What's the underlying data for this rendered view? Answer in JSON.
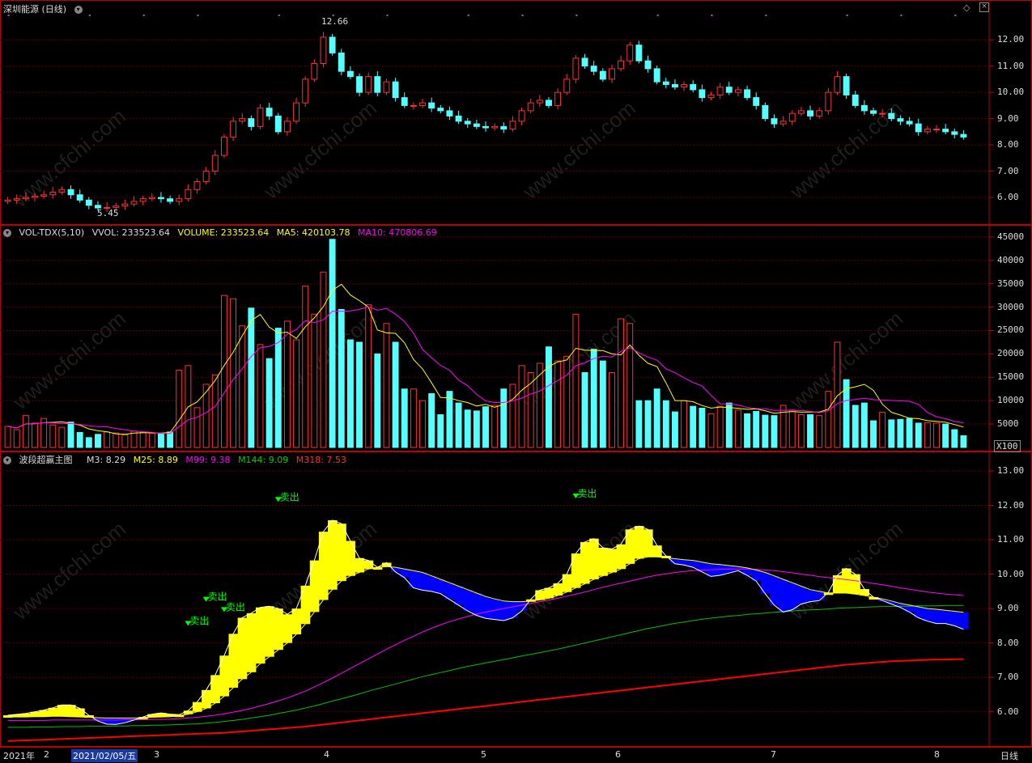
{
  "price_panel": {
    "title": "深圳能源 (日线)",
    "high_label": "12.66",
    "low_label": "5.45",
    "y_ticks": [
      "12.00",
      "11.00",
      "10.00",
      "9.00",
      "8.00",
      "7.00",
      "6.00"
    ],
    "y_values": [
      12,
      11,
      10,
      9,
      8,
      7,
      6
    ]
  },
  "vol_panel": {
    "name": "VOL-TDX(5,10)",
    "vvol": "VVOL: 233523.64",
    "volume": "VOLUME: 233523.64",
    "ma5": "MA5: 420103.78",
    "ma10": "MA10: 470806.69",
    "y_ticks": [
      "45000",
      "40000",
      "35000",
      "30000",
      "25000",
      "20000",
      "15000",
      "10000",
      "5000"
    ],
    "y_values": [
      45000,
      40000,
      35000,
      30000,
      25000,
      20000,
      15000,
      10000,
      5000
    ],
    "unit": "X100"
  },
  "ind_panel": {
    "name": "波段超赢主图",
    "m3": "M3: 8.29",
    "m25": "M25: 8.89",
    "m99": "M99: 9.38",
    "m144": "M144: 9.09",
    "m318": "M318: 7.53",
    "y_ticks": [
      "13.00",
      "12.00",
      "11.00",
      "10.00",
      "9.00",
      "8.00",
      "7.00",
      "6.00"
    ],
    "y_values": [
      13,
      12,
      11,
      10,
      9,
      8,
      7,
      6
    ],
    "sell_label": "卖出",
    "sell_marks": [
      {
        "bar": 10,
        "value": 8.5
      },
      {
        "bar": 11,
        "value": 9.2
      },
      {
        "bar": 12,
        "value": 8.9
      },
      {
        "bar": 15,
        "value": 12.1
      },
      {
        "bar": 29,
        "value": 12.2
      }
    ]
  },
  "date_bar": {
    "labels": [
      "2021年",
      "2",
      "2021/02/05/五",
      "3",
      "4",
      "5",
      "6",
      "7",
      "8"
    ],
    "period": "日线"
  },
  "watermark": "www.cfchi.com",
  "colors": {
    "up": "#ff3232",
    "down": "#54ffff",
    "ma5": "#ffff00",
    "ma10": "#ff00ff",
    "m144": "#00c000",
    "m318": "#ff0000",
    "band_up": "#ffff00",
    "band_down": "#0000ff",
    "grid": "#b00000"
  },
  "chart_data": {
    "type": "candlestick",
    "title": "深圳能源 (日线)",
    "price_max": 12.66,
    "price_min": 5.45,
    "closes": [
      5.9,
      5.95,
      6.0,
      6.05,
      6.1,
      6.2,
      6.3,
      6.1,
      5.9,
      5.7,
      5.6,
      5.62,
      5.68,
      5.75,
      5.85,
      5.95,
      6.0,
      5.95,
      5.85,
      5.95,
      6.3,
      6.6,
      7.0,
      7.6,
      8.3,
      8.9,
      9.0,
      8.7,
      9.4,
      9.1,
      8.5,
      8.9,
      9.6,
      10.5,
      11.1,
      12.1,
      11.5,
      10.8,
      10.6,
      10.0,
      10.6,
      10.0,
      10.4,
      9.8,
      9.5,
      9.5,
      9.6,
      9.4,
      9.3,
      9.1,
      8.9,
      8.8,
      8.7,
      8.65,
      8.7,
      8.6,
      8.9,
      9.3,
      9.6,
      9.7,
      9.5,
      10.0,
      10.5,
      11.3,
      11.0,
      10.8,
      10.5,
      10.9,
      11.2,
      11.8,
      11.2,
      10.9,
      10.4,
      10.3,
      10.2,
      10.3,
      10.1,
      9.8,
      9.9,
      10.2,
      10.0,
      10.1,
      9.8,
      9.5,
      9.0,
      8.8,
      8.9,
      9.2,
      9.3,
      9.1,
      9.3,
      10.0,
      10.6,
      9.9,
      9.5,
      9.3,
      9.2,
      9.2,
      9.0,
      8.9,
      8.8,
      8.5,
      8.6,
      8.6,
      8.5,
      8.4,
      8.3
    ],
    "volumes": [
      4500,
      3800,
      6800,
      5200,
      6200,
      4800,
      4300,
      5400,
      3200,
      2100,
      2800,
      3300,
      3100,
      2700,
      3500,
      3200,
      3100,
      2900,
      3300,
      16500,
      17500,
      8500,
      13500,
      15500,
      32500,
      31800,
      26000,
      29800,
      22000,
      19000,
      25500,
      27000,
      23000,
      34500,
      28500,
      37500,
      44500,
      29500,
      23000,
      22500,
      30500,
      20000,
      26500,
      22500,
      12500,
      12500,
      10000,
      11500,
      7000,
      12000,
      9500,
      8000,
      7800,
      8700,
      9000,
      12500,
      13500,
      17500,
      16000,
      18000,
      21500,
      18500,
      19500,
      28500,
      16000,
      21000,
      18500,
      16000,
      27500,
      26500,
      10000,
      10000,
      12500,
      10000,
      7600,
      10000,
      8800,
      8400,
      7200,
      8800,
      9500,
      8000,
      7200,
      7700,
      6900,
      6800,
      9000,
      8000,
      7000,
      7000,
      6800,
      12000,
      22500,
      14500,
      9000,
      9500,
      5700,
      7500,
      5900,
      6000,
      6200,
      5200,
      5300,
      5200,
      5000,
      3800,
      2500
    ],
    "m25": [
      5.85,
      5.85,
      5.85,
      5.86,
      5.86,
      5.87,
      5.87,
      5.86,
      5.85,
      5.84,
      5.83,
      5.82,
      5.82,
      5.82,
      5.82,
      5.83,
      5.84,
      5.85,
      5.86,
      5.88,
      5.93,
      6.0,
      6.1,
      6.25,
      6.45,
      6.7,
      6.95,
      7.15,
      7.4,
      7.6,
      7.8,
      8.0,
      8.25,
      8.55,
      8.9,
      9.25,
      9.55,
      9.8,
      9.95,
      10.05,
      10.15,
      10.2,
      10.22,
      10.2,
      10.15,
      10.1,
      10.05,
      9.95,
      9.85,
      9.75,
      9.65,
      9.55,
      9.45,
      9.35,
      9.28,
      9.22,
      9.2,
      9.2,
      9.22,
      9.25,
      9.3,
      9.38,
      9.48,
      9.6,
      9.72,
      9.85,
      9.95,
      10.05,
      10.15,
      10.3,
      10.45,
      10.5,
      10.5,
      10.48,
      10.45,
      10.42,
      10.4,
      10.35,
      10.3,
      10.28,
      10.25,
      10.22,
      10.18,
      10.12,
      10.05,
      9.95,
      9.85,
      9.75,
      9.65,
      9.55,
      9.5,
      9.45,
      9.45,
      9.45,
      9.42,
      9.38,
      9.33,
      9.28,
      9.22,
      9.15,
      9.1,
      9.05,
      9.0,
      8.98,
      8.95,
      8.92,
      8.89
    ],
    "m99": [
      5.75,
      5.75,
      5.75,
      5.75,
      5.75,
      5.76,
      5.76,
      5.76,
      5.76,
      5.76,
      5.76,
      5.76,
      5.76,
      5.77,
      5.77,
      5.77,
      5.78,
      5.78,
      5.79,
      5.8,
      5.82,
      5.84,
      5.87,
      5.9,
      5.94,
      5.99,
      6.04,
      6.1,
      6.17,
      6.24,
      6.32,
      6.4,
      6.5,
      6.6,
      6.72,
      6.85,
      6.98,
      7.12,
      7.26,
      7.4,
      7.54,
      7.68,
      7.82,
      7.95,
      8.08,
      8.2,
      8.32,
      8.43,
      8.53,
      8.62,
      8.7,
      8.77,
      8.84,
      8.9,
      8.95,
      9.0,
      9.05,
      9.1,
      9.15,
      9.2,
      9.25,
      9.3,
      9.36,
      9.42,
      9.48,
      9.55,
      9.62,
      9.68,
      9.74,
      9.8,
      9.86,
      9.92,
      9.97,
      10.01,
      10.05,
      10.08,
      10.1,
      10.12,
      10.13,
      10.14,
      10.15,
      10.15,
      10.15,
      10.14,
      10.12,
      10.1,
      10.07,
      10.04,
      10.0,
      9.97,
      9.93,
      9.9,
      9.87,
      9.84,
      9.81,
      9.77,
      9.73,
      9.69,
      9.65,
      9.6,
      9.56,
      9.52,
      9.48,
      9.45,
      9.42,
      9.4,
      9.38
    ],
    "m144": [
      5.55,
      5.55,
      5.55,
      5.56,
      5.56,
      5.56,
      5.57,
      5.57,
      5.57,
      5.58,
      5.58,
      5.58,
      5.59,
      5.59,
      5.6,
      5.6,
      5.61,
      5.61,
      5.62,
      5.63,
      5.64,
      5.65,
      5.67,
      5.69,
      5.72,
      5.75,
      5.78,
      5.82,
      5.86,
      5.9,
      5.95,
      6.0,
      6.05,
      6.11,
      6.17,
      6.24,
      6.31,
      6.38,
      6.45,
      6.52,
      6.6,
      6.67,
      6.74,
      6.81,
      6.88,
      6.95,
      7.02,
      7.08,
      7.14,
      7.2,
      7.26,
      7.32,
      7.37,
      7.42,
      7.47,
      7.52,
      7.57,
      7.62,
      7.67,
      7.72,
      7.77,
      7.82,
      7.88,
      7.94,
      8.0,
      8.06,
      8.12,
      8.18,
      8.24,
      8.3,
      8.36,
      8.42,
      8.47,
      8.52,
      8.57,
      8.61,
      8.65,
      8.69,
      8.72,
      8.75,
      8.78,
      8.8,
      8.83,
      8.85,
      8.87,
      8.89,
      8.91,
      8.93,
      8.95,
      8.96,
      8.97,
      8.99,
      9.01,
      9.02,
      9.03,
      9.04,
      9.05,
      9.06,
      9.06,
      9.07,
      9.07,
      9.08,
      9.08,
      9.08,
      9.09,
      9.09,
      9.09
    ],
    "m318": [
      5.15,
      5.16,
      5.17,
      5.18,
      5.19,
      5.2,
      5.21,
      5.22,
      5.23,
      5.24,
      5.25,
      5.26,
      5.27,
      5.28,
      5.29,
      5.3,
      5.31,
      5.32,
      5.33,
      5.34,
      5.35,
      5.36,
      5.37,
      5.38,
      5.39,
      5.41,
      5.43,
      5.45,
      5.47,
      5.49,
      5.51,
      5.53,
      5.55,
      5.57,
      5.6,
      5.63,
      5.66,
      5.69,
      5.72,
      5.75,
      5.78,
      5.81,
      5.84,
      5.87,
      5.9,
      5.93,
      5.96,
      5.99,
      6.02,
      6.05,
      6.08,
      6.11,
      6.14,
      6.17,
      6.2,
      6.23,
      6.26,
      6.29,
      6.32,
      6.35,
      6.38,
      6.41,
      6.44,
      6.47,
      6.5,
      6.53,
      6.56,
      6.59,
      6.62,
      6.65,
      6.68,
      6.71,
      6.74,
      6.77,
      6.8,
      6.83,
      6.86,
      6.89,
      6.92,
      6.95,
      6.98,
      7.01,
      7.04,
      7.07,
      7.1,
      7.13,
      7.16,
      7.19,
      7.22,
      7.25,
      7.28,
      7.31,
      7.34,
      7.37,
      7.39,
      7.41,
      7.43,
      7.45,
      7.47,
      7.48,
      7.49,
      7.5,
      7.51,
      7.52,
      7.52,
      7.53,
      7.53
    ]
  }
}
